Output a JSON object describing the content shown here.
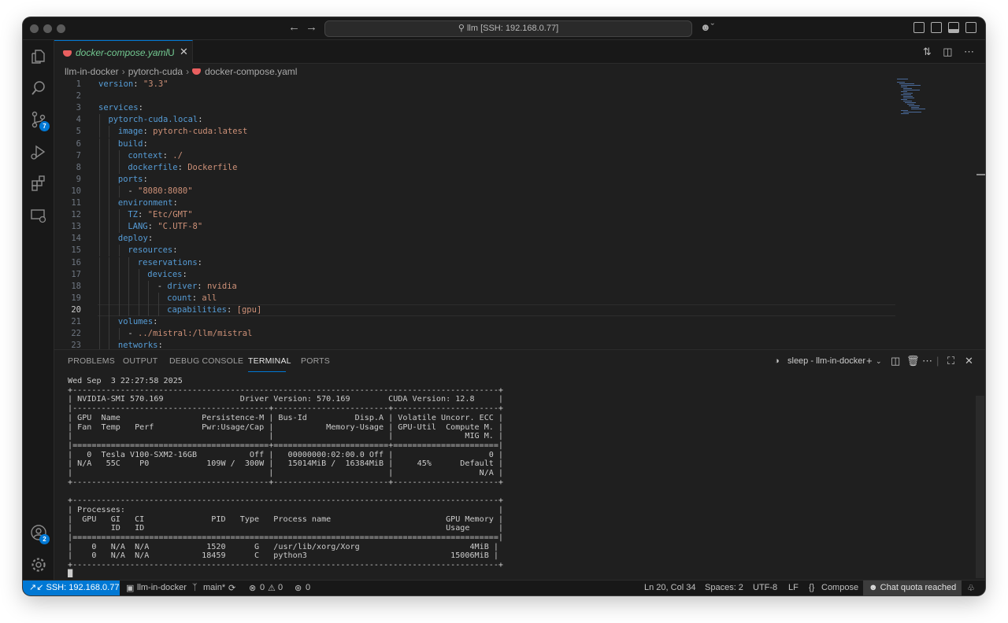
{
  "titlebar": {
    "command_center": "llm [SSH: 192.168.0.77]"
  },
  "activity_bar": {
    "scm_badge": "7",
    "accounts_badge": "2"
  },
  "tabs": [
    {
      "label": "docker-compose.yaml",
      "status": "U"
    }
  ],
  "breadcrumb": [
    "llm-in-docker",
    "pytorch-cuda",
    "docker-compose.yaml"
  ],
  "editor": {
    "current_line": 20,
    "lines": [
      {
        "n": "1",
        "key": "version",
        "val": "\"3.3\"",
        "indent": 0
      },
      {
        "n": "2",
        "key": "",
        "val": "",
        "indent": 0
      },
      {
        "n": "3",
        "key": "services",
        "val": "",
        "indent": 0
      },
      {
        "n": "4",
        "key": "pytorch-cuda.local",
        "val": "",
        "indent": 1
      },
      {
        "n": "5",
        "key": "image",
        "val": "pytorch-cuda:latest",
        "indent": 2
      },
      {
        "n": "6",
        "key": "build",
        "val": "",
        "indent": 2
      },
      {
        "n": "7",
        "key": "context",
        "val": "./",
        "indent": 3
      },
      {
        "n": "8",
        "key": "dockerfile",
        "val": "Dockerfile",
        "indent": 3
      },
      {
        "n": "9",
        "key": "ports",
        "val": "",
        "indent": 2
      },
      {
        "n": "10",
        "key": "",
        "val": "\"8080:8080\"",
        "indent": 3,
        "dash": true
      },
      {
        "n": "11",
        "key": "environment",
        "val": "",
        "indent": 2
      },
      {
        "n": "12",
        "key": "TZ",
        "val": "\"Etc/GMT\"",
        "indent": 3
      },
      {
        "n": "13",
        "key": "LANG",
        "val": "\"C.UTF-8\"",
        "indent": 3
      },
      {
        "n": "14",
        "key": "deploy",
        "val": "",
        "indent": 2
      },
      {
        "n": "15",
        "key": "resources",
        "val": "",
        "indent": 3
      },
      {
        "n": "16",
        "key": "reservations",
        "val": "",
        "indent": 4
      },
      {
        "n": "17",
        "key": "devices",
        "val": "",
        "indent": 5
      },
      {
        "n": "18",
        "key": "driver",
        "val": "nvidia",
        "indent": 6,
        "dash": true
      },
      {
        "n": "19",
        "key": "count",
        "val": "all",
        "indent": 7
      },
      {
        "n": "20",
        "key": "capabilities",
        "val": "[gpu]",
        "indent": 7
      },
      {
        "n": "21",
        "key": "volumes",
        "val": "",
        "indent": 2
      },
      {
        "n": "22",
        "key": "",
        "val": "../mistral:/llm/mistral",
        "indent": 3,
        "dash": true
      },
      {
        "n": "23",
        "key": "networks",
        "val": "",
        "indent": 2
      }
    ]
  },
  "panel": {
    "tabs": [
      "PROBLEMS",
      "OUTPUT",
      "DEBUG CONSOLE",
      "TERMINAL",
      "PORTS"
    ],
    "active_tab": "TERMINAL",
    "terminal_name": "sleep - llm-in-docker",
    "terminal_output": "Wed Sep  3 22:27:58 2025\n+-----------------------------------------------------------------------------------------+\n| NVIDIA-SMI 570.169                Driver Version: 570.169        CUDA Version: 12.8     |\n|-----------------------------------------+------------------------+----------------------+\n| GPU  Name                 Persistence-M | Bus-Id          Disp.A | Volatile Uncorr. ECC |\n| Fan  Temp   Perf          Pwr:Usage/Cap |           Memory-Usage | GPU-Util  Compute M. |\n|                                         |                        |               MIG M. |\n|=========================================+========================+======================|\n|   0  Tesla V100-SXM2-16GB           Off |   00000000:02:00.0 Off |                    0 |\n| N/A   55C    P0            109W /  300W |   15014MiB /  16384MiB |     45%      Default |\n|                                         |                        |                  N/A |\n+-----------------------------------------+------------------------+----------------------+\n\n+-----------------------------------------------------------------------------------------+\n| Processes:                                                                              |\n|  GPU   GI   CI              PID   Type   Process name                        GPU Memory |\n|        ID   ID                                                               Usage      |\n|=========================================================================================|\n|    0   N/A  N/A            1520      G   /usr/lib/xorg/Xorg                       4MiB |\n|    0   N/A  N/A           18459      C   python3                              15006MiB |\n+-----------------------------------------------------------------------------------------+\n█"
  },
  "statusbar": {
    "remote": "SSH: 192.168.0.77",
    "folder": "llm-in-docker",
    "branch": "main*",
    "errors": "0",
    "warnings": "0",
    "ports": "0",
    "position": "Ln 20, Col 34",
    "spaces": "Spaces: 2",
    "encoding": "UTF-8",
    "eol": "LF",
    "language": "Compose",
    "chat": "Chat quota reached"
  },
  "colors": {
    "accent": "#0078d4",
    "yaml_key": "#569cd6",
    "yaml_string": "#ce9178",
    "untracked": "#73c991"
  }
}
